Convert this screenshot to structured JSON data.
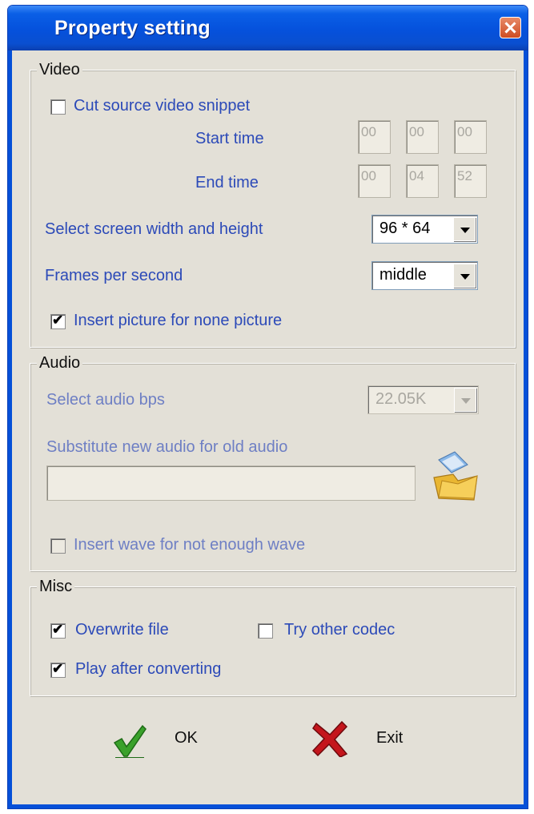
{
  "window": {
    "title": "Property setting"
  },
  "video": {
    "group_label": "Video",
    "cut_snippet": {
      "label": "Cut source video snippet",
      "checked": false
    },
    "start_time": {
      "label": "Start time",
      "hh": "00",
      "mm": "00",
      "ss": "00"
    },
    "end_time": {
      "label": "End time",
      "hh": "00",
      "mm": "04",
      "ss": "52"
    },
    "screen_size": {
      "label": "Select screen width and height",
      "value": "96 * 64"
    },
    "fps": {
      "label": "Frames per second",
      "value": "middle"
    },
    "insert_picture": {
      "label": "Insert picture for none picture",
      "checked": true
    }
  },
  "audio": {
    "group_label": "Audio",
    "bps": {
      "label": "Select audio bps",
      "value": "22.05K"
    },
    "substitute": {
      "label": "Substitute new audio for old audio",
      "value": ""
    },
    "insert_wave": {
      "label": "Insert wave for not enough wave",
      "checked": false
    }
  },
  "misc": {
    "group_label": "Misc",
    "overwrite": {
      "label": "Overwrite file",
      "checked": true
    },
    "try_codec": {
      "label": "Try other codec",
      "checked": false
    },
    "play_after": {
      "label": "Play after converting",
      "checked": true
    }
  },
  "buttons": {
    "ok_label": "OK",
    "exit_label": "Exit"
  },
  "colors": {
    "titlebar": "#0551dc",
    "dialog_bg": "#e3e0d7",
    "label_text": "#2c4ab8",
    "ok_check": "#3aa12b",
    "exit_cross": "#c4161c"
  }
}
